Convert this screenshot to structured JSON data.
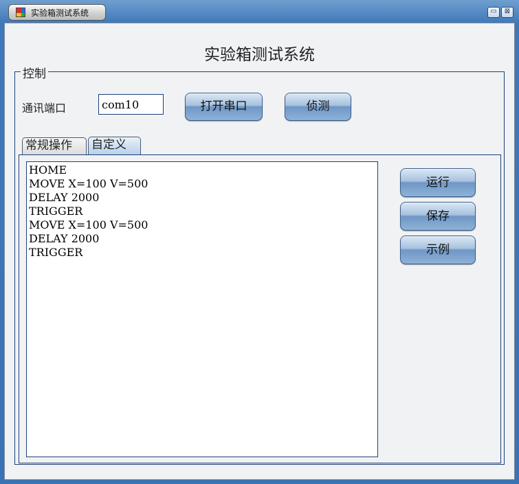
{
  "window": {
    "title": "实验箱测试系统",
    "minimize_glyph": "▭",
    "close_glyph": "⊠"
  },
  "main": {
    "heading": "实验箱测试系统",
    "control_group": {
      "legend": "控制",
      "port_label": "通讯端口",
      "port_value": "com10",
      "open_port_button": "打开串口",
      "detect_button": "侦测"
    },
    "tabs": [
      {
        "label": "常规操作",
        "selected": false
      },
      {
        "label": "自定义",
        "selected": true
      }
    ],
    "script_lines": [
      "HOME",
      "MOVE X=100 V=500",
      "DELAY 2000",
      "TRIGGER",
      "MOVE X=100 V=500",
      "DELAY 2000",
      "TRIGGER"
    ],
    "run_button": "运行",
    "save_button": "保存",
    "example_button": "示例"
  },
  "colors": {
    "titlebar": "#3f78b8",
    "border": "#1a3f7a",
    "button_gradient_mid": "#6f97c6",
    "background": "#f1f2f4"
  },
  "icons": {
    "app": "windows-flag-icon",
    "minimize": "minimize-icon",
    "close": "close-icon"
  }
}
